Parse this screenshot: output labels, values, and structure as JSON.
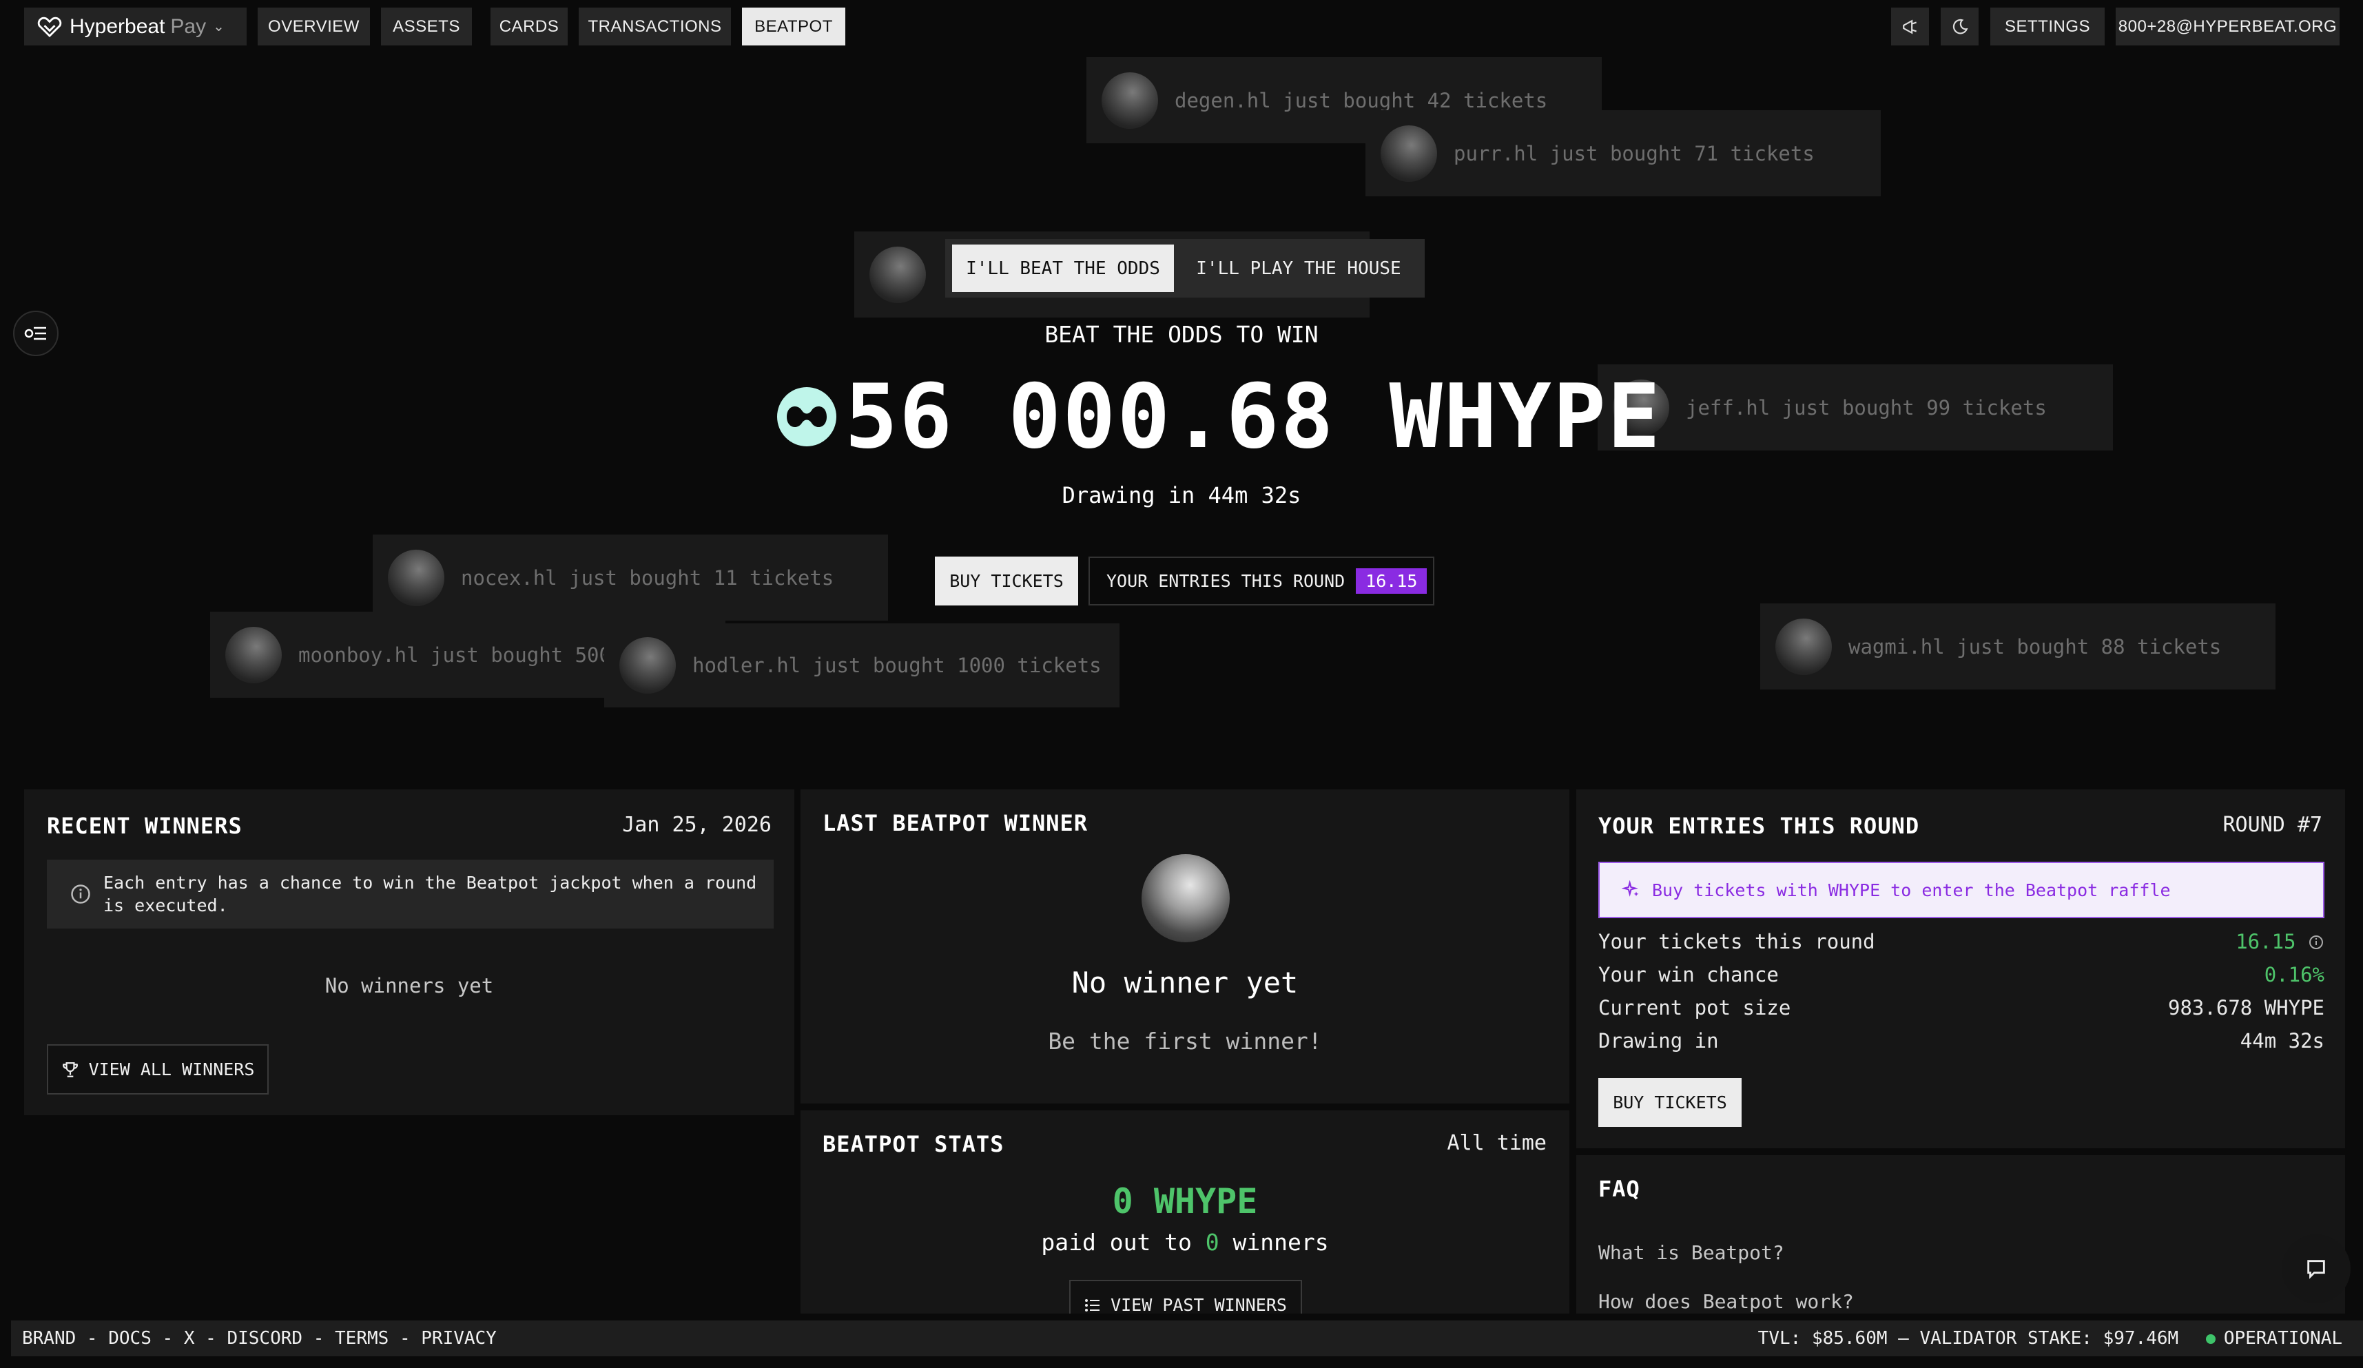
{
  "brand": {
    "name": "Hyperbeat",
    "sub": "Pay"
  },
  "nav": {
    "items": [
      "OVERVIEW",
      "ASSETS",
      "CARDS",
      "TRANSACTIONS",
      "BEATPOT"
    ],
    "active": "BEATPOT",
    "settings": "SETTINGS",
    "account": "800+28@HYPERBEAT.ORG"
  },
  "ticker": [
    {
      "text": "degen.hl just bought 42 tickets"
    },
    {
      "text": "purr.hl just bought 71 tickets"
    },
    {
      "text": "jeff.hl just bought 99 tickets"
    },
    {
      "text": "nocex.hl just bought 11 tickets"
    },
    {
      "text": "moonboy.hl just bought 500 tickets"
    },
    {
      "text": "hodler.hl just bought 1000 tickets"
    },
    {
      "text": "wagmi.hl just bought 88 tickets"
    }
  ],
  "hero": {
    "toggle_a": "I'LL BEAT THE ODDS",
    "toggle_b": "I'LL PLAY THE HOUSE",
    "label": "BEAT THE ODDS TO WIN",
    "jackpot": "56 000.68 WHYPE",
    "drawing": "Drawing in 44m 32s",
    "buy": "BUY TICKETS",
    "entries_label": "YOUR ENTRIES THIS ROUND",
    "entries_value": "16.15"
  },
  "recent_winners": {
    "title": "RECENT WINNERS",
    "date": "Jan 25, 2026",
    "info": "Each entry has a chance to win the Beatpot jackpot when a round is executed.",
    "empty": "No winners yet",
    "button": "VIEW ALL WINNERS"
  },
  "last_winner": {
    "title": "LAST BEATPOT WINNER",
    "name": "No winner yet",
    "sub": "Be the first winner!"
  },
  "stats": {
    "title": "BEATPOT STATS",
    "range": "All time",
    "amount": "0 WHYPE",
    "paid_prefix": "paid out to",
    "winners_count": "0",
    "paid_suffix": "winners",
    "button": "VIEW PAST WINNERS"
  },
  "entries": {
    "title": "YOUR ENTRIES THIS ROUND",
    "round": "ROUND #7",
    "banner": "Buy tickets with WHYPE to enter the Beatpot raffle",
    "rows": [
      {
        "label": "Your tickets this round",
        "value": "16.15"
      },
      {
        "label": "Your win chance",
        "value": "0.16%"
      },
      {
        "label": "Current pot size",
        "value": "983.678 WHYPE"
      },
      {
        "label": "Drawing in",
        "value": "44m 32s"
      }
    ],
    "button": "BUY TICKETS"
  },
  "faq": {
    "title": "FAQ",
    "items": [
      "What is Beatpot?",
      "How does Beatpot work?"
    ]
  },
  "footer": {
    "links": [
      "BRAND",
      "DOCS",
      "X",
      "DISCORD",
      "TERMS",
      "PRIVACY"
    ],
    "status": "TVL: $85.60M — VALIDATOR STAKE: $97.46M",
    "operational": "OPERATIONAL"
  }
}
